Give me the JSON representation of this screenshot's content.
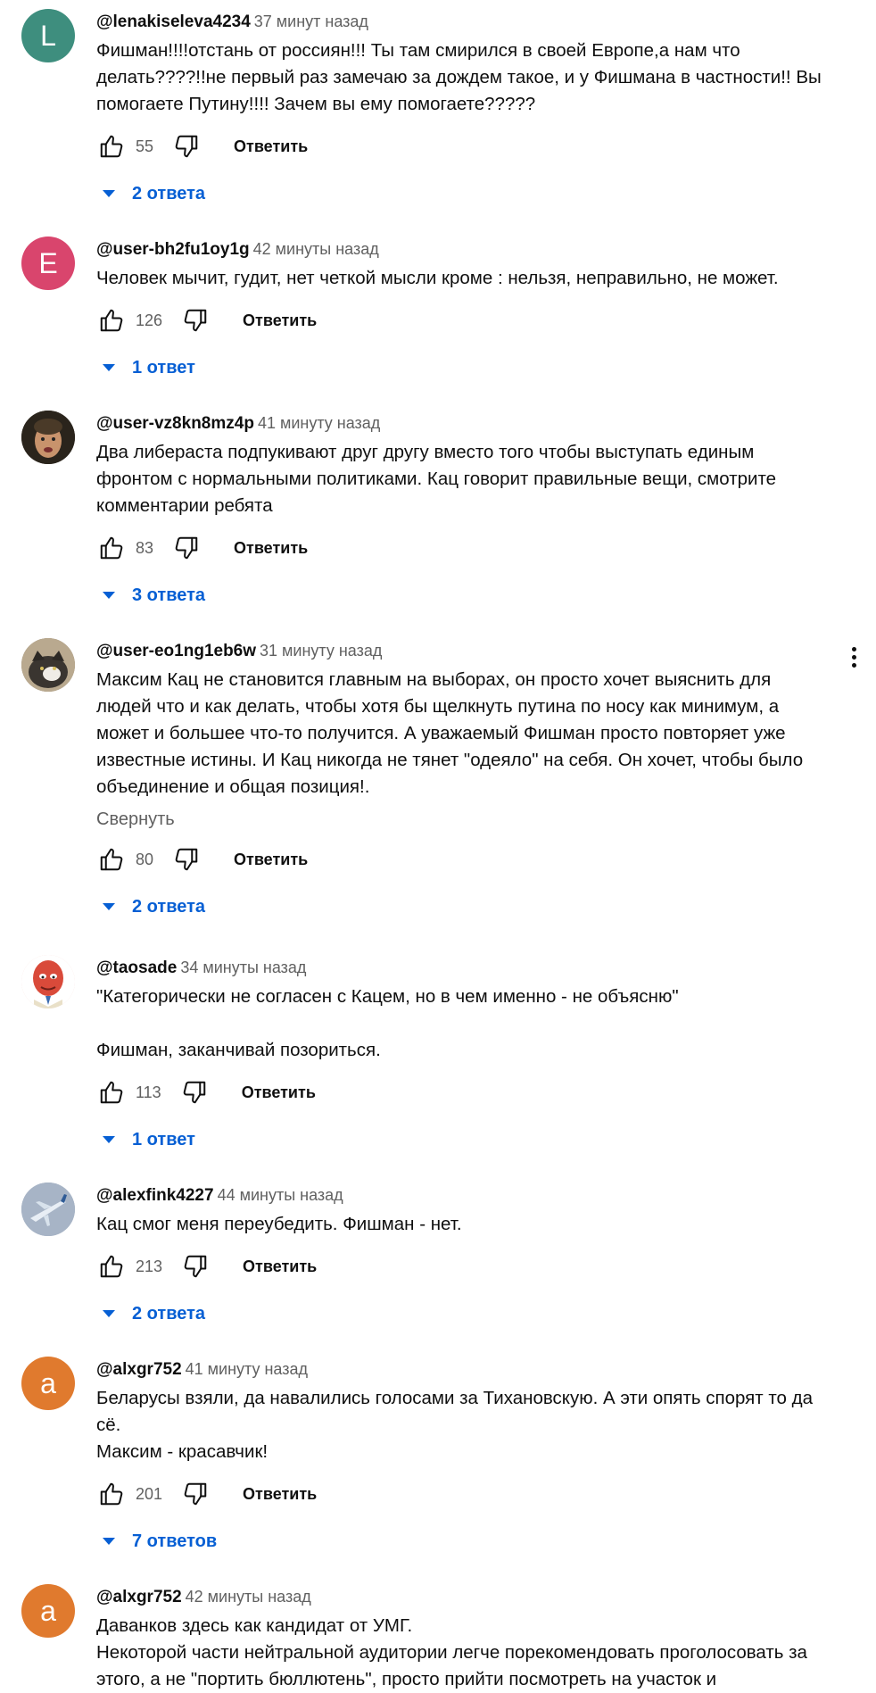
{
  "comments": [
    {
      "author": "@lenakiseleva4234",
      "time": "37 минут назад",
      "avatar_letter": "L",
      "avatar_color": "#3e8e7e",
      "text": "Фишман!!!!отстань от россиян!!! Ты там смирился в своей Европе,а нам что делать????!!не первый раз замечаю за дождем такое, и у Фишмана в частности!! Вы помогаете Путину!!!! Зачем вы ему помогаете?????",
      "likes": "55",
      "reply_label": "Ответить",
      "replies": "2 ответа"
    },
    {
      "author": "@user-bh2fu1oy1g",
      "time": "42 минуты назад",
      "avatar_letter": "E",
      "avatar_color": "#d9456d",
      "text": "Человек мычит, гудит, нет четкой мысли кроме : нельзя, неправильно, не может.",
      "likes": "126",
      "reply_label": "Ответить",
      "replies": "1 ответ"
    },
    {
      "author": "@user-vz8kn8mz4p",
      "time": "41 минуту назад",
      "avatar_letter": "",
      "avatar_color": "#3b3327",
      "text": "Два либераста подпукивают друг другу вместо того чтобы выступать единым фронтом с нормальными политиками. Кац говорит правильные вещи, смотрите комментарии ребята",
      "likes": "83",
      "reply_label": "Ответить",
      "replies": "3 ответа"
    },
    {
      "author": "@user-eo1ng1eb6w",
      "time": "31 минуту назад",
      "avatar_letter": "",
      "avatar_color": "#8a7a64",
      "text": "Максим Кац не становится главным на выборах, он просто хочет выяснить для людей что и как делать, чтобы хотя бы щелкнуть путина по носу как минимум, а может и большее что-то получится. А уважаемый Фишман просто повторяет уже известные истины. И Кац никогда не тянет \"одеяло\" на себя. Он хочет, чтобы было объединение и общая позиция!.",
      "collapse": "Свернуть",
      "likes": "80",
      "reply_label": "Ответить",
      "replies": "2 ответа"
    },
    {
      "author": "@taosade",
      "time": "34 минуты назад",
      "avatar_letter": "",
      "avatar_color": "#f6c9c2",
      "text": "\"Категорически не согласен с Кацем, но в чем именно - не объясню\"\n\nФишман, заканчивай позориться.",
      "likes": "113",
      "reply_label": "Ответить",
      "replies": "1 ответ"
    },
    {
      "author": "@alexfink4227",
      "time": "44 минуты назад",
      "avatar_letter": "",
      "avatar_color": "#9aa8bd",
      "text": "Кац смог меня переубедить. Фишман - нет.",
      "likes": "213",
      "reply_label": "Ответить",
      "replies": "2 ответа"
    },
    {
      "author": "@alxgr752",
      "time": "41 минуту назад",
      "avatar_letter": "a",
      "avatar_color": "#e07a2e",
      "text": "Беларусы взяли, да навалились голосами за Тихановскую. А эти опять спорят то да сё.\nМаксим - красавчик!",
      "likes": "201",
      "reply_label": "Ответить",
      "replies": "7 ответов"
    },
    {
      "author": "@alxgr752",
      "time": "42 минуты назад",
      "avatar_letter": "a",
      "avatar_color": "#e07a2e",
      "text": "Даванков здесь как кандидат от УМГ.\nНекоторой части нейтральной аудитории легче порекомендовать проголосовать за этого, а не \"портить бюллютень\", просто прийти посмотреть на участок и"
    }
  ]
}
